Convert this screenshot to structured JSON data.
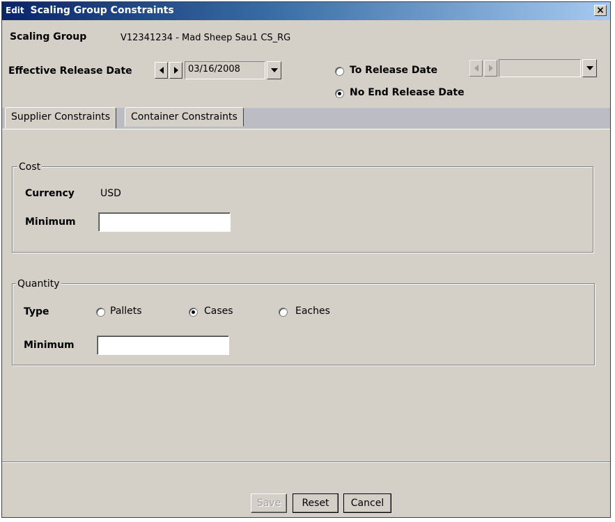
{
  "window": {
    "title_prefix": "Edit",
    "title": "Scaling Group Constraints",
    "close_glyph": "×"
  },
  "scaling_group": {
    "label": "Scaling Group",
    "value": "V12341234 - Mad Sheep Sau1 CS_RG"
  },
  "effective_release": {
    "label": "Effective Release Date",
    "date": "03/16/2008"
  },
  "end_options": {
    "to_release_label": "To Release Date",
    "to_release_selected": false,
    "no_end_label": "No End Release Date",
    "no_end_selected": true,
    "to_release_value": ""
  },
  "tabs": [
    {
      "label": "Supplier Constraints",
      "active": true
    },
    {
      "label": "Container Constraints",
      "active": false
    }
  ],
  "cost": {
    "legend": "Cost",
    "currency_label": "Currency",
    "currency_value": "USD",
    "minimum_label": "Minimum",
    "minimum_value": ""
  },
  "quantity": {
    "legend": "Quantity",
    "type_label": "Type",
    "options": [
      {
        "label": "Pallets",
        "selected": false
      },
      {
        "label": "Cases",
        "selected": true
      },
      {
        "label": "Eaches",
        "selected": false
      }
    ],
    "minimum_label": "Minimum",
    "minimum_value": ""
  },
  "footer": {
    "save_label": "Save",
    "save_enabled": false,
    "reset_label": "Reset",
    "cancel_label": "Cancel"
  },
  "icons": {
    "arrow_left": "arrow-left-icon",
    "arrow_right": "arrow-right-icon",
    "dropdown": "chevron-down-icon",
    "close": "close-icon"
  }
}
